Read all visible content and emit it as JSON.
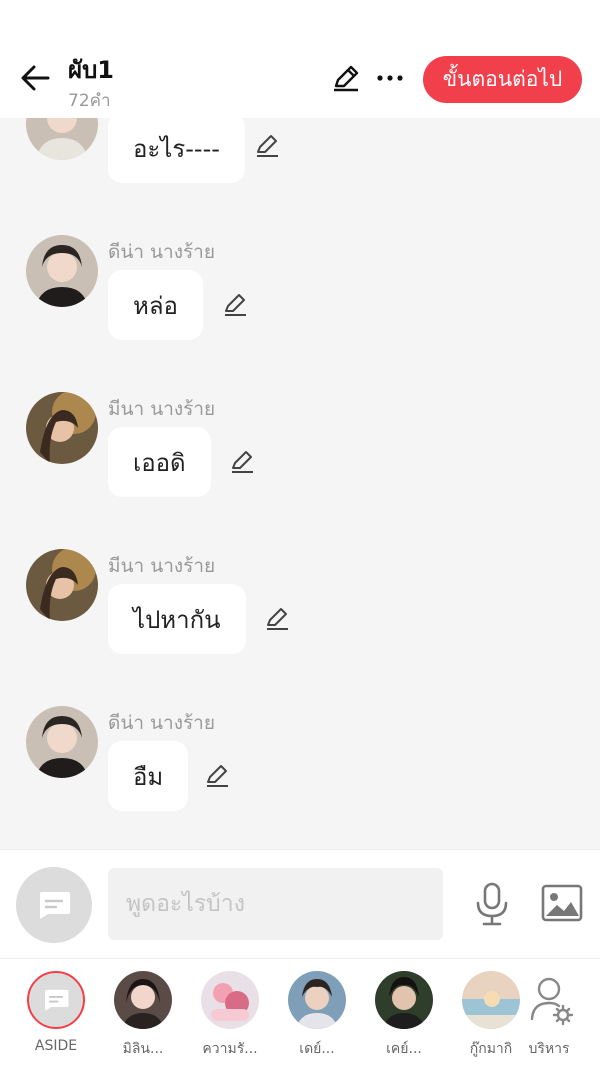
{
  "header": {
    "title": "ผับ1",
    "subtitle": "72คำ",
    "next_label": "ขั้นตอนต่อไป"
  },
  "messages": [
    {
      "sender": "",
      "text": "อะไร----"
    },
    {
      "sender": "ดีน่า นางร้าย",
      "text": "หล่อ"
    },
    {
      "sender": "มีนา นางร้าย",
      "text": "เออดิ"
    },
    {
      "sender": "มีนา นางร้าย",
      "text": "ไปหากัน"
    },
    {
      "sender": "ดีน่า นางร้าย",
      "text": "อืม"
    }
  ],
  "input": {
    "placeholder": "พูดอะไรบ้าง"
  },
  "nav": {
    "items": [
      {
        "label": "ASIDE"
      },
      {
        "label": "มิลิน..."
      },
      {
        "label": "ความรั..."
      },
      {
        "label": "เดย์..."
      },
      {
        "label": "เคย์..."
      },
      {
        "label": "กู๊กมากิ"
      },
      {
        "label": "บริหาร"
      }
    ]
  },
  "colors": {
    "accent": "#f1404b",
    "background": "#f5f5f5"
  }
}
